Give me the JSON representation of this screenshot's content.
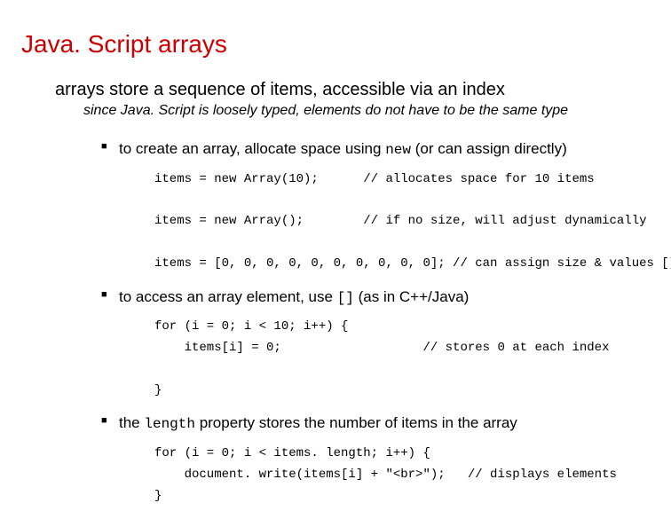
{
  "title": "Java. Script arrays",
  "intro": "arrays store a sequence of items, accessible via an index",
  "subintro": "since Java. Script is loosely typed, elements do not have to be the same type",
  "bullet1": {
    "pre": "to create an array, allocate space using ",
    "mono": "new",
    "post": "   (or can assign directly)",
    "code": "items = new Array(10);      // allocates space for 10 items\n\nitems = new Array();        // if no size, will adjust dynamically\n\nitems = [0, 0, 0, 0, 0, 0, 0, 0, 0, 0]; // can assign size & values []"
  },
  "bullet2": {
    "pre": "to access an array element, use ",
    "mono": "[]",
    "post": " (as in C++/Java)",
    "code": "for (i = 0; i < 10; i++) {\n    items[i] = 0;                   // stores 0 at each index\n\n}"
  },
  "bullet3": {
    "pre": "the ",
    "mono": "length",
    "post": " property stores the number of items in the array",
    "code": "for (i = 0; i < items. length; i++) {\n    document. write(items[i] + \"<br>\");   // displays elements\n}"
  }
}
